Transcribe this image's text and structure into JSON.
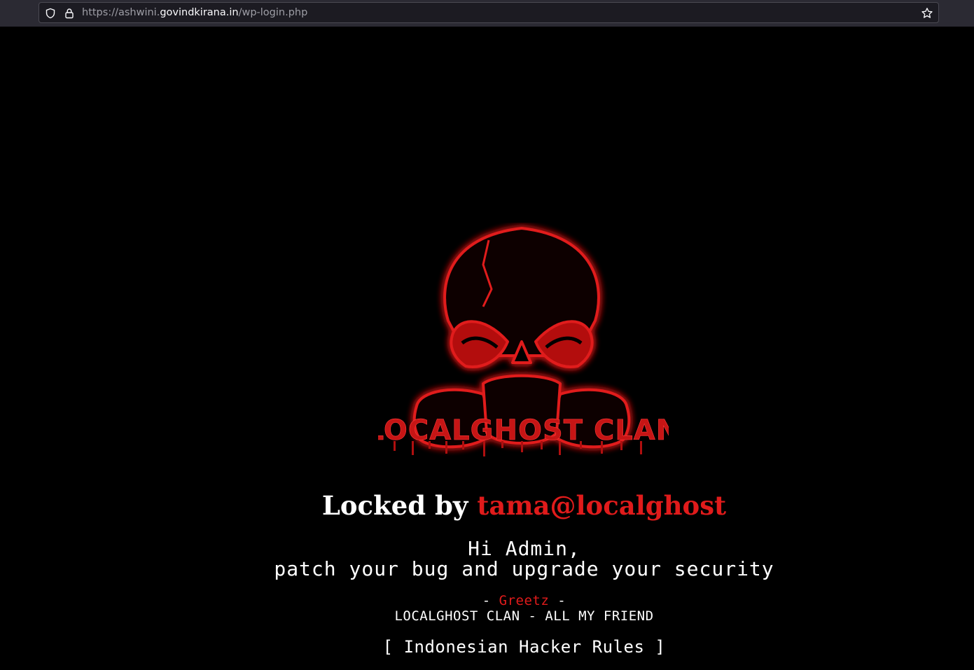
{
  "browser": {
    "url_prefix": "https://ashwini.",
    "url_domain": "govindkirana.in",
    "url_path": "/wp-login.php",
    "icons": [
      "shield-icon",
      "lock-icon",
      "star-icon"
    ]
  },
  "page": {
    "logo_text": "LOCALGHOST CLAN",
    "headline_prefix": "Locked by ",
    "headline_handle": "tama@localghost",
    "message_line1": "Hi Admin,",
    "message_line2": "patch your bug and upgrade your security",
    "greetz_left": "- ",
    "greetz_word": "Greetz",
    "greetz_right": " -",
    "friends_line": "LOCALGHOST CLAN - ALL MY FRIEND",
    "rules_line": "[ Indonesian Hacker Rules ]"
  },
  "colors": {
    "background": "#000000",
    "accent_red": "#e01b1b",
    "text": "#ffffff"
  }
}
